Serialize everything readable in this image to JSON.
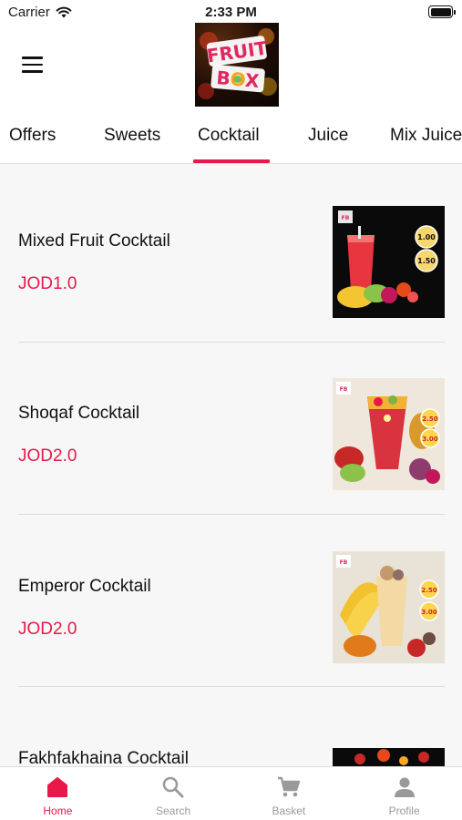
{
  "status_bar": {
    "carrier": "Carrier",
    "time": "2:33 PM"
  },
  "header": {
    "logo_text": "Fruit Box"
  },
  "categories": [
    {
      "label": "Offers",
      "active": false
    },
    {
      "label": "Sweets",
      "active": false
    },
    {
      "label": "Cocktail",
      "active": true
    },
    {
      "label": "Juice",
      "active": false
    },
    {
      "label": "Mix Juice",
      "active": false
    }
  ],
  "products": [
    {
      "name": "Mixed Fruit Cocktail",
      "price": "JOD1.0",
      "image_price_1": "1.00",
      "image_price_2": "1.50"
    },
    {
      "name": "Shoqaf Cocktail",
      "price": "JOD2.0",
      "image_price_1": "2.50",
      "image_price_2": "3.00"
    },
    {
      "name": "Emperor Cocktail",
      "price": "JOD2.0",
      "image_price_1": "2.50",
      "image_price_2": "3.00"
    },
    {
      "name": "Fakhfakhaina Cocktail",
      "price": ""
    }
  ],
  "tabbar": [
    {
      "label": "Home",
      "icon": "home-icon",
      "active": true
    },
    {
      "label": "Search",
      "icon": "search-icon",
      "active": false
    },
    {
      "label": "Basket",
      "icon": "cart-icon",
      "active": false
    },
    {
      "label": "Profile",
      "icon": "profile-icon",
      "active": false
    }
  ],
  "colors": {
    "accent": "#e8194a",
    "inactive": "#9a9a9a",
    "background": "#f7f7f7"
  }
}
